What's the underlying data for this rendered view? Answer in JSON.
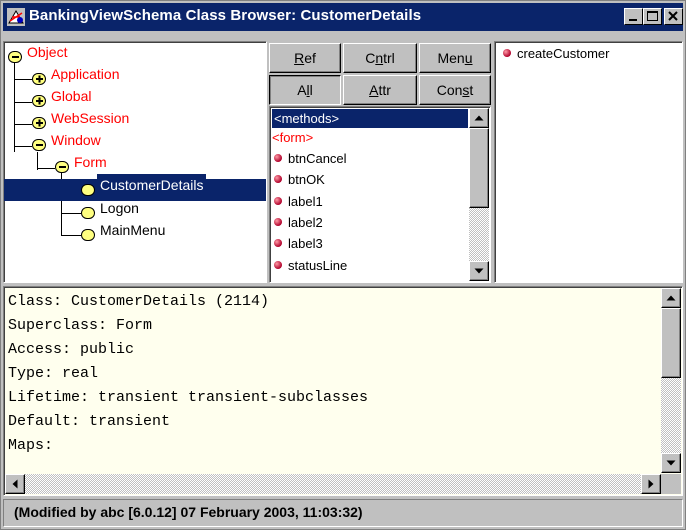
{
  "window": {
    "title": "BankingViewSchema Class Browser: CustomerDetails",
    "controls": [
      "minimize",
      "maximize",
      "close"
    ]
  },
  "tree": {
    "items": [
      {
        "label": "Object",
        "state": "expanded",
        "color": "#ff0000"
      },
      {
        "label": "Application",
        "state": "collapsed",
        "color": "#ff0000"
      },
      {
        "label": "Global",
        "state": "collapsed",
        "color": "#ff0000"
      },
      {
        "label": "WebSession",
        "state": "collapsed",
        "color": "#ff0000"
      },
      {
        "label": "Window",
        "state": "expanded",
        "color": "#ff0000"
      },
      {
        "label": "Form",
        "state": "expanded",
        "color": "#ff0000"
      },
      {
        "label": "CustomerDetails",
        "state": "leaf",
        "selected": true
      },
      {
        "label": "Logon",
        "state": "leaf"
      },
      {
        "label": "MainMenu",
        "state": "leaf"
      }
    ]
  },
  "toolbar": {
    "ref": "Ref",
    "cntrl": "Cntrl",
    "menu": "Menu",
    "all": "All",
    "attr": "Attr",
    "const": "Const",
    "pressed": "All"
  },
  "members": {
    "header": "<methods>",
    "section": "<form>",
    "items": [
      "btnCancel",
      "btnOK",
      "label1",
      "label2",
      "label3",
      "statusLine"
    ]
  },
  "methods": {
    "items": [
      "createCustomer"
    ]
  },
  "details": {
    "lines": [
      "Class: CustomerDetails (2114)",
      "Superclass: Form",
      "Access: public",
      "Type: real",
      "Lifetime: transient transient-subclasses",
      "Default: transient",
      "Maps:"
    ]
  },
  "status": {
    "text": "(Modified by abc [6.0.12] 07 February 2003, 11:03:32)"
  },
  "colors": {
    "titlebar": "#0a246a",
    "selection": "#0a246a",
    "details_bg": "#ffffee",
    "red_text": "#ff0000"
  }
}
